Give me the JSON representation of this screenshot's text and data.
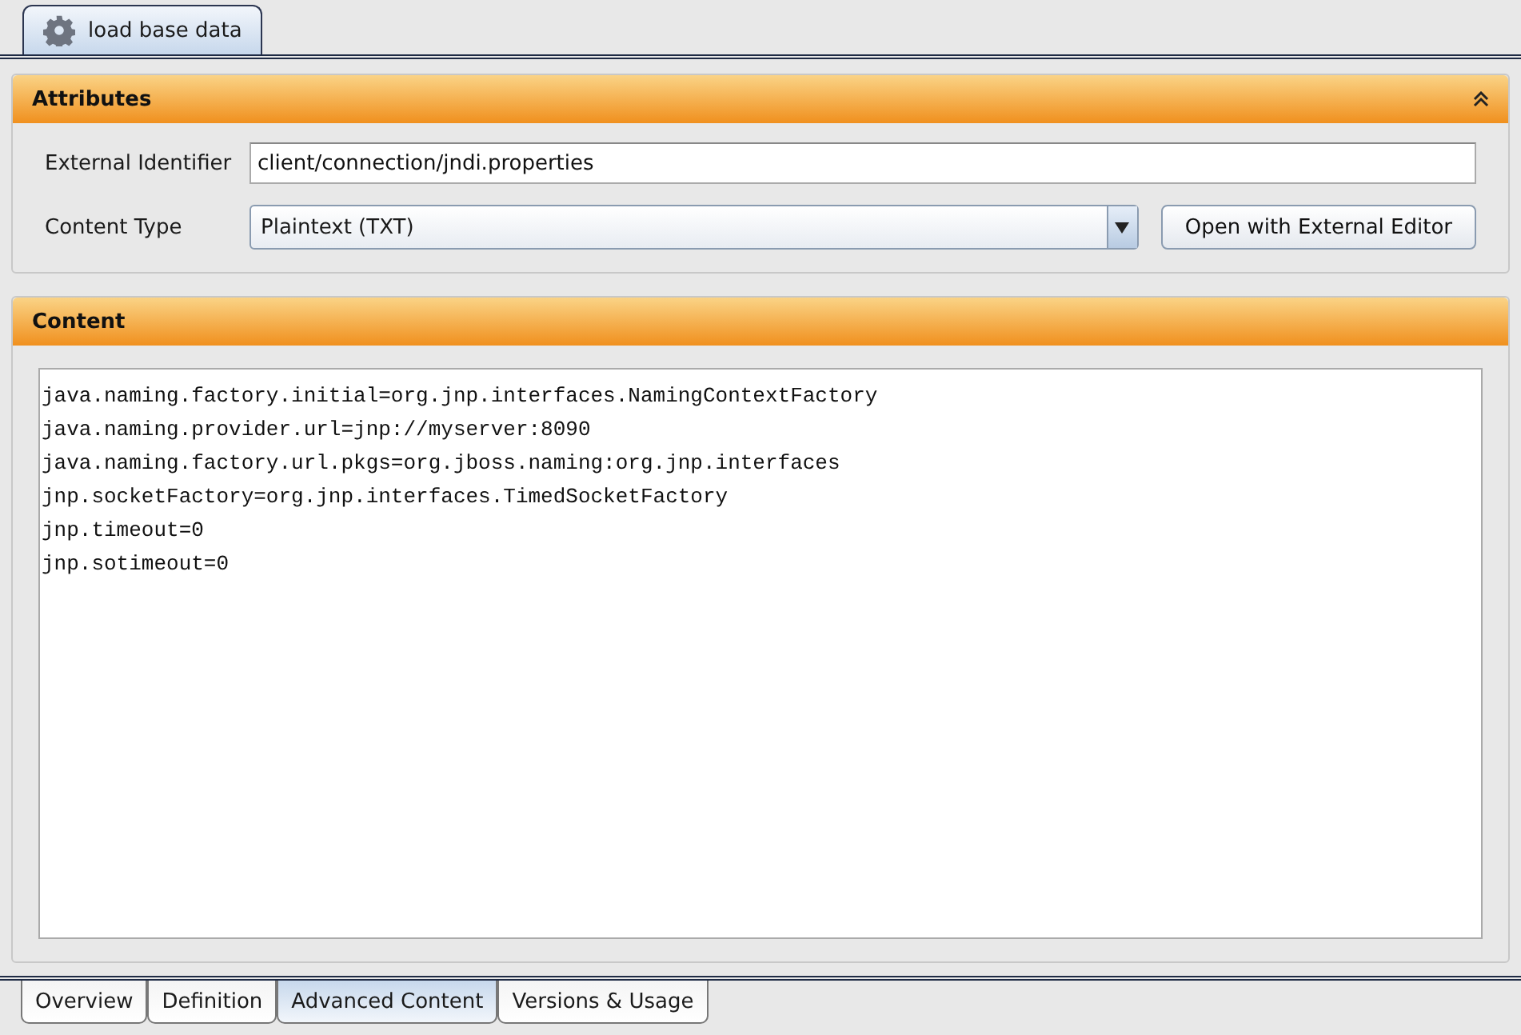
{
  "top_tabs": [
    {
      "label": "load base data",
      "selected": true
    }
  ],
  "attributes": {
    "title": "Attributes",
    "expanded": true,
    "external_identifier": {
      "label": "External Identifier",
      "value": "client/connection/jndi.properties"
    },
    "content_type": {
      "label": "Content Type",
      "value": "Plaintext (TXT)"
    },
    "button": "Open with External Editor"
  },
  "content": {
    "title": "Content",
    "lines": [
      "java.naming.factory.initial=org.jnp.interfaces.NamingContextFactory",
      "java.naming.provider.url=jnp://myserver:8090",
      "java.naming.factory.url.pkgs=org.jboss.naming:org.jnp.interfaces",
      "jnp.socketFactory=org.jnp.interfaces.TimedSocketFactory",
      "jnp.timeout=0",
      "jnp.sotimeout=0"
    ]
  },
  "bottom_tabs": [
    {
      "label": "Overview",
      "selected": false
    },
    {
      "label": "Definition",
      "selected": false
    },
    {
      "label": "Advanced Content",
      "selected": true
    },
    {
      "label": "Versions & Usage",
      "selected": false
    }
  ]
}
